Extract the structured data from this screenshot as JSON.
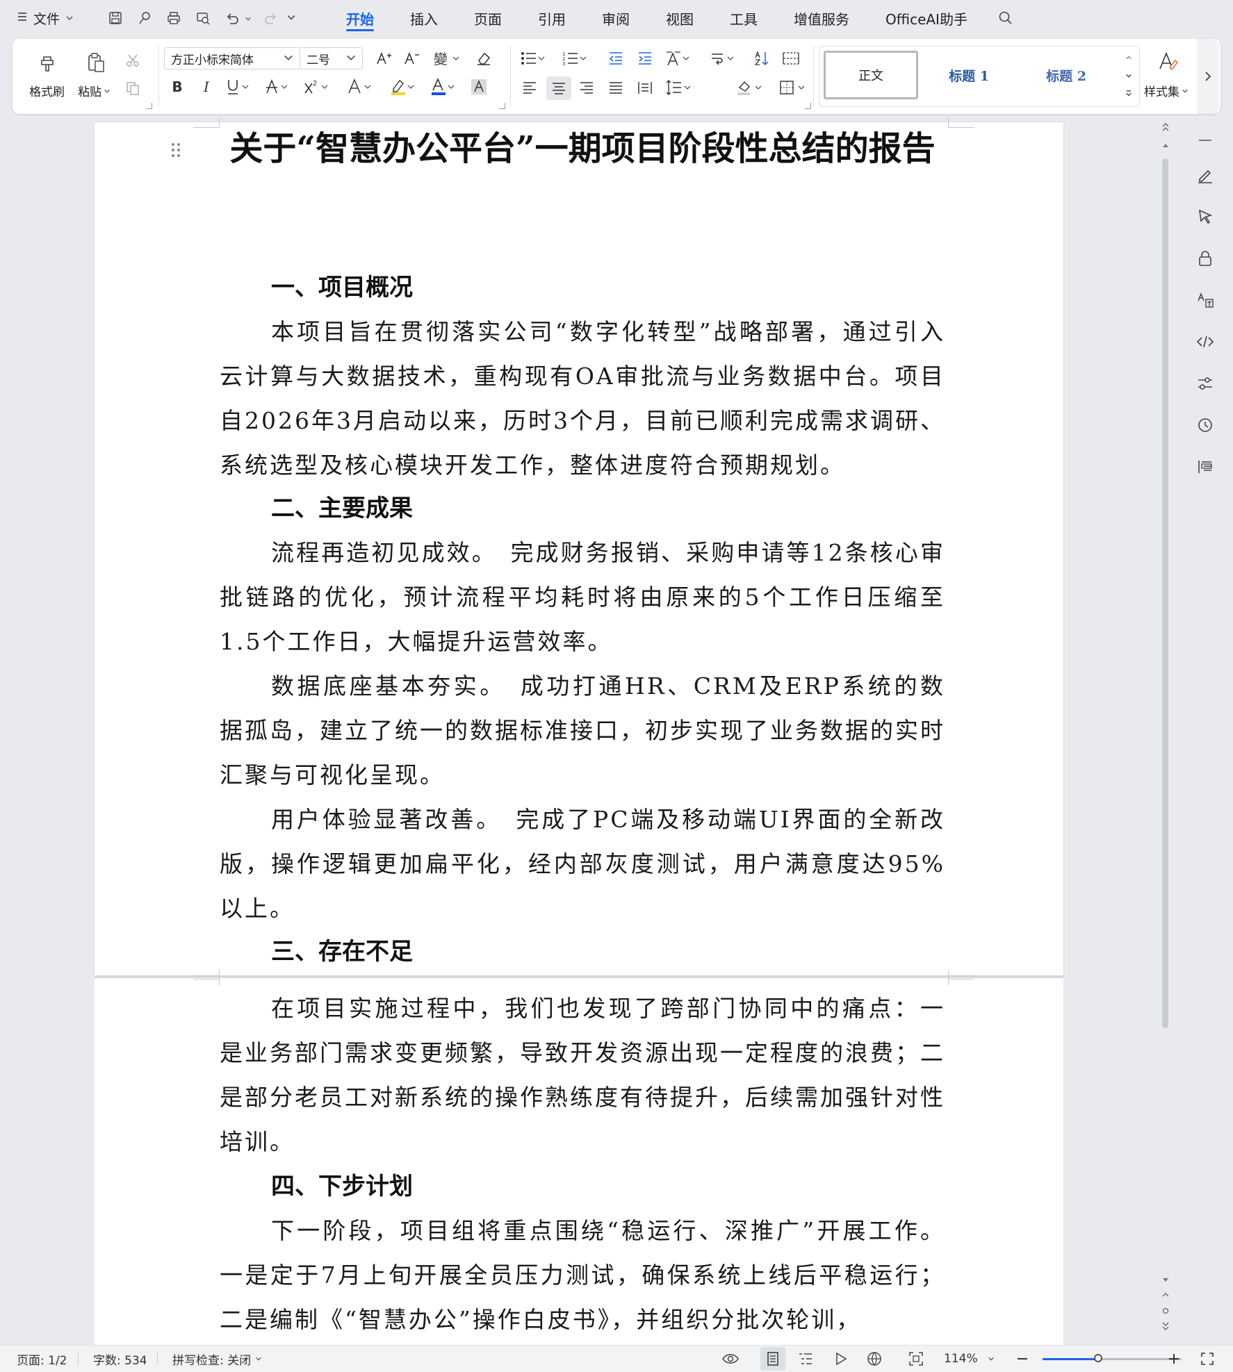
{
  "menubar": {
    "file_label": "文件",
    "tabs": [
      {
        "label": "开始",
        "active": true
      },
      {
        "label": "插入"
      },
      {
        "label": "页面"
      },
      {
        "label": "引用"
      },
      {
        "label": "审阅"
      },
      {
        "label": "视图"
      },
      {
        "label": "工具"
      },
      {
        "label": "增值服务"
      },
      {
        "label": "OfficeAI助手"
      }
    ]
  },
  "ribbon": {
    "format_painter_label": "格式刷",
    "paste_label": "粘贴",
    "font_name": "方正小标宋简体",
    "font_size": "二号",
    "styles": {
      "normal": "正文",
      "heading1": "标题 1",
      "heading2": "标题 2"
    },
    "style_set_label": "样式集",
    "accent_color": "#1a63e8",
    "highlight_color": "#f3d23a",
    "font_color": "#1a4fd6"
  },
  "document": {
    "title": "关于“智慧办公平台”一期项目阶段性总结的报告",
    "sections": [
      {
        "heading": "一、项目概况",
        "paragraphs": [
          "本项目旨在贯彻落实公司“数字化转型”战略部署，通过引入云计算与大数据技术，重构现有OA审批流与业务数据中台。项目自2026年3月启动以来，历时3个月，目前已顺利完成需求调研、系统选型及核心模块开发工作，整体进度符合预期规划。"
        ]
      },
      {
        "heading": "二、主要成果",
        "paragraphs": [
          "流程再造初见成效。　完成财务报销、采购申请等12条核心审批链路的优化，预计流程平均耗时将由原来的5个工作日压缩至1.5个工作日，大幅提升运营效率。",
          "数据底座基本夯实。　成功打通HR、CRM及ERP系统的数据孤岛，建立了统一的数据标准接口，初步实现了业务数据的实时汇聚与可视化呈现。",
          "用户体验显著改善。　完成了PC端及移动端UI界面的全新改版，操作逻辑更加扁平化，经内部灰度测试，用户满意度达95%以上。"
        ]
      },
      {
        "heading": "三、存在不足",
        "paragraphs": [
          "在项目实施过程中，我们也发现了跨部门协同中的痛点：一是业务部门需求变更频繁，导致开发资源出现一定程度的浪费；二是部分老员工对新系统的操作熟练度有待提升，后续需加强针对性培训。"
        ]
      },
      {
        "heading": "四、下步计划",
        "paragraphs": [
          "下一阶段，项目组将重点围绕“稳运行、深推广”开展工作。一是定于7月上旬开展全员压力测试，确保系统上线后平稳运行；二是编制《“智慧办公”操作白皮书》，并组织分批次轮训，"
        ]
      }
    ]
  },
  "statusbar": {
    "page": "页面: 1/2",
    "word_count": "字数: 534",
    "spell_check": "拼写检查: 关闭",
    "zoom": "114%",
    "zoom_fraction": 0.4
  },
  "side_panel_icons": [
    "pen-icon",
    "select-cursor-icon",
    "lock-icon",
    "translate-icon",
    "code-icon",
    "settings-sliders-icon",
    "history-icon",
    "outline-icon"
  ]
}
